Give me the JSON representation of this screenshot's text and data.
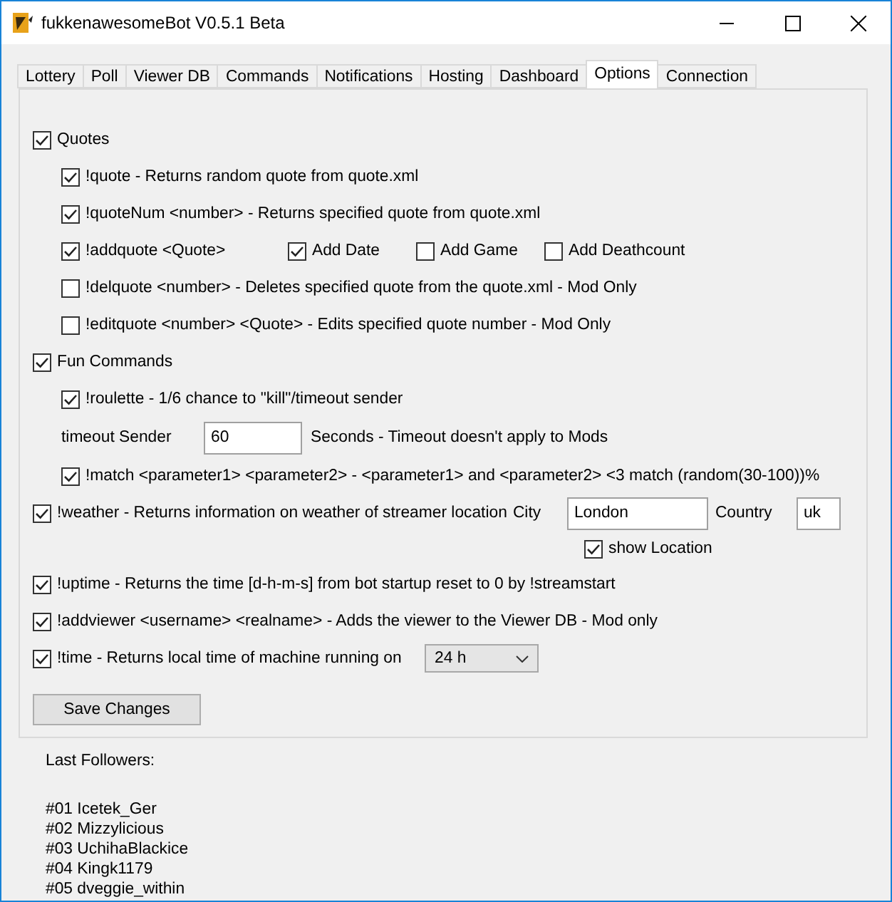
{
  "window": {
    "title": "fukkenawesomeBot V0.5.1 Beta"
  },
  "tabs": [
    {
      "label": "Lottery",
      "selected": false
    },
    {
      "label": "Poll",
      "selected": false
    },
    {
      "label": "Viewer DB",
      "selected": false
    },
    {
      "label": "Commands",
      "selected": false
    },
    {
      "label": "Notifications",
      "selected": false
    },
    {
      "label": "Hosting",
      "selected": false
    },
    {
      "label": "Dashboard",
      "selected": false
    },
    {
      "label": "Options",
      "selected": true
    },
    {
      "label": "Connection",
      "selected": false
    }
  ],
  "options": [
    {
      "kind": "group",
      "label": "Quotes",
      "checked": true,
      "children": [
        {
          "kind": "check",
          "label": "!quote - Returns random quote from quote.xml",
          "checked": true
        },
        {
          "kind": "check",
          "label": "!quoteNum <number> - Returns specified quote from quote.xml",
          "checked": true
        },
        {
          "kind": "extras",
          "label": "!addquote <Quote>",
          "checked": true,
          "extras": [
            {
              "label": "Add Date",
              "checked": true
            },
            {
              "label": "Add Game",
              "checked": false
            },
            {
              "label": "Add Deathcount",
              "checked": false
            }
          ]
        },
        {
          "kind": "check",
          "label": "!delquote <number> - Deletes specified quote from the quote.xml - Mod Only",
          "checked": false
        },
        {
          "kind": "check",
          "label": "!editquote <number> <Quote> - Edits specified quote number - Mod Only",
          "checked": false
        }
      ]
    },
    {
      "kind": "group",
      "label": "Fun Commands",
      "checked": true,
      "children": [
        {
          "kind": "check",
          "label": "!roulette - 1/6 chance to \"kill\"/timeout sender",
          "checked": true
        },
        {
          "kind": "field",
          "label": "timeout Sender",
          "value": "60",
          "note": "Seconds - Timeout doesn't apply to Mods"
        },
        {
          "kind": "check",
          "label": "!match <parameter1> <parameter2> - <parameter1> and <parameter2> <3 match (random(30-100))%",
          "checked": true
        }
      ]
    },
    {
      "kind": "weather",
      "label": "!weather - Returns information on weather of streamer location",
      "checked": true,
      "city_label": "City",
      "city": "London",
      "country_label": "Country",
      "country": "uk",
      "show_location": {
        "label": "show Location",
        "checked": true
      }
    },
    {
      "kind": "check",
      "label": "!uptime - Returns the time [d-h-m-s] from bot startup reset to 0 by !streamstart",
      "checked": true
    },
    {
      "kind": "check",
      "label": "!addviewer <username> <realname> - Adds the viewer to the Viewer DB - Mod only",
      "checked": true
    },
    {
      "kind": "select",
      "label": "!time - Returns local time of machine running on",
      "checked": true,
      "value": "24 h"
    }
  ],
  "save_button": "Save Changes",
  "followers": {
    "title": "Last Followers:",
    "items": [
      "#01 Icetek_Ger",
      "#02 Mizzylicious",
      "#03 UchihaBlackice",
      "#04 Kingk1179",
      "#05 dveggie_within"
    ]
  }
}
